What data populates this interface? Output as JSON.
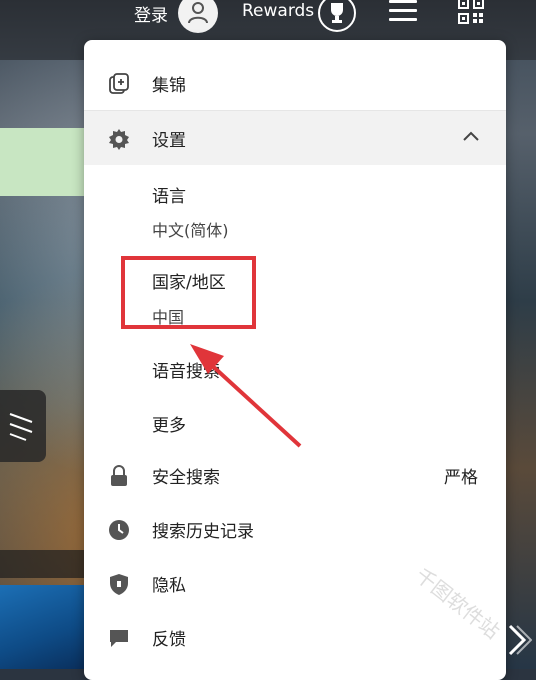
{
  "topbar": {
    "signin_label": "登录",
    "rewards_label": "Rewards"
  },
  "menu": {
    "collections": "集锦",
    "settings": "设置",
    "language_label": "语言",
    "language_value": "中文(简体)",
    "region_label": "国家/地区",
    "region_value": "中国",
    "voice_search": "语音搜索",
    "more": "更多",
    "safesearch": "安全搜索",
    "safesearch_value": "严格",
    "search_history": "搜索历史记录",
    "privacy": "隐私",
    "feedback": "反馈"
  },
  "watermark": "千图软件站",
  "colors": {
    "highlight": "#e0353a",
    "panel_bg": "#ffffff",
    "settings_row_bg": "#f2f2f2"
  }
}
